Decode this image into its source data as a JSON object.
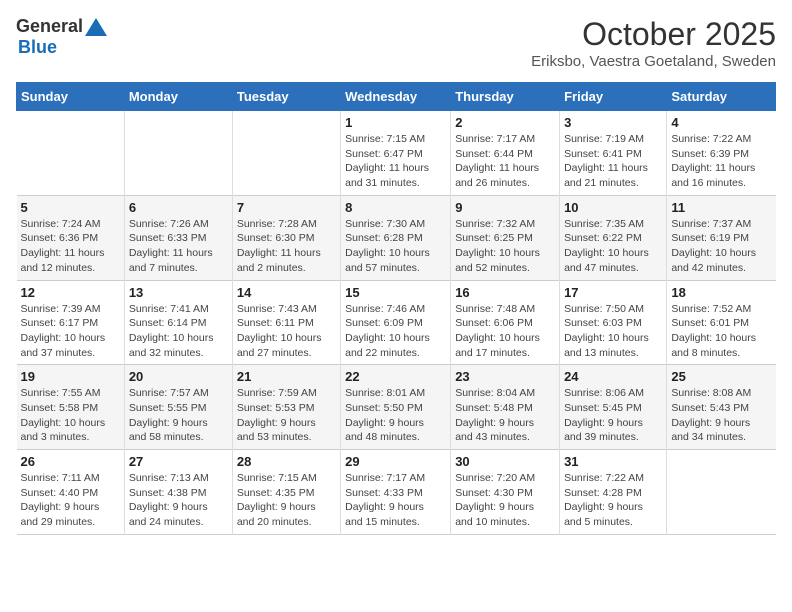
{
  "header": {
    "logo_general": "General",
    "logo_blue": "Blue",
    "month": "October 2025",
    "location": "Eriksbo, Vaestra Goetaland, Sweden"
  },
  "days_of_week": [
    "Sunday",
    "Monday",
    "Tuesday",
    "Wednesday",
    "Thursday",
    "Friday",
    "Saturday"
  ],
  "weeks": [
    [
      {
        "day": "",
        "info": ""
      },
      {
        "day": "",
        "info": ""
      },
      {
        "day": "",
        "info": ""
      },
      {
        "day": "1",
        "info": "Sunrise: 7:15 AM\nSunset: 6:47 PM\nDaylight: 11 hours\nand 31 minutes."
      },
      {
        "day": "2",
        "info": "Sunrise: 7:17 AM\nSunset: 6:44 PM\nDaylight: 11 hours\nand 26 minutes."
      },
      {
        "day": "3",
        "info": "Sunrise: 7:19 AM\nSunset: 6:41 PM\nDaylight: 11 hours\nand 21 minutes."
      },
      {
        "day": "4",
        "info": "Sunrise: 7:22 AM\nSunset: 6:39 PM\nDaylight: 11 hours\nand 16 minutes."
      }
    ],
    [
      {
        "day": "5",
        "info": "Sunrise: 7:24 AM\nSunset: 6:36 PM\nDaylight: 11 hours\nand 12 minutes."
      },
      {
        "day": "6",
        "info": "Sunrise: 7:26 AM\nSunset: 6:33 PM\nDaylight: 11 hours\nand 7 minutes."
      },
      {
        "day": "7",
        "info": "Sunrise: 7:28 AM\nSunset: 6:30 PM\nDaylight: 11 hours\nand 2 minutes."
      },
      {
        "day": "8",
        "info": "Sunrise: 7:30 AM\nSunset: 6:28 PM\nDaylight: 10 hours\nand 57 minutes."
      },
      {
        "day": "9",
        "info": "Sunrise: 7:32 AM\nSunset: 6:25 PM\nDaylight: 10 hours\nand 52 minutes."
      },
      {
        "day": "10",
        "info": "Sunrise: 7:35 AM\nSunset: 6:22 PM\nDaylight: 10 hours\nand 47 minutes."
      },
      {
        "day": "11",
        "info": "Sunrise: 7:37 AM\nSunset: 6:19 PM\nDaylight: 10 hours\nand 42 minutes."
      }
    ],
    [
      {
        "day": "12",
        "info": "Sunrise: 7:39 AM\nSunset: 6:17 PM\nDaylight: 10 hours\nand 37 minutes."
      },
      {
        "day": "13",
        "info": "Sunrise: 7:41 AM\nSunset: 6:14 PM\nDaylight: 10 hours\nand 32 minutes."
      },
      {
        "day": "14",
        "info": "Sunrise: 7:43 AM\nSunset: 6:11 PM\nDaylight: 10 hours\nand 27 minutes."
      },
      {
        "day": "15",
        "info": "Sunrise: 7:46 AM\nSunset: 6:09 PM\nDaylight: 10 hours\nand 22 minutes."
      },
      {
        "day": "16",
        "info": "Sunrise: 7:48 AM\nSunset: 6:06 PM\nDaylight: 10 hours\nand 17 minutes."
      },
      {
        "day": "17",
        "info": "Sunrise: 7:50 AM\nSunset: 6:03 PM\nDaylight: 10 hours\nand 13 minutes."
      },
      {
        "day": "18",
        "info": "Sunrise: 7:52 AM\nSunset: 6:01 PM\nDaylight: 10 hours\nand 8 minutes."
      }
    ],
    [
      {
        "day": "19",
        "info": "Sunrise: 7:55 AM\nSunset: 5:58 PM\nDaylight: 10 hours\nand 3 minutes."
      },
      {
        "day": "20",
        "info": "Sunrise: 7:57 AM\nSunset: 5:55 PM\nDaylight: 9 hours\nand 58 minutes."
      },
      {
        "day": "21",
        "info": "Sunrise: 7:59 AM\nSunset: 5:53 PM\nDaylight: 9 hours\nand 53 minutes."
      },
      {
        "day": "22",
        "info": "Sunrise: 8:01 AM\nSunset: 5:50 PM\nDaylight: 9 hours\nand 48 minutes."
      },
      {
        "day": "23",
        "info": "Sunrise: 8:04 AM\nSunset: 5:48 PM\nDaylight: 9 hours\nand 43 minutes."
      },
      {
        "day": "24",
        "info": "Sunrise: 8:06 AM\nSunset: 5:45 PM\nDaylight: 9 hours\nand 39 minutes."
      },
      {
        "day": "25",
        "info": "Sunrise: 8:08 AM\nSunset: 5:43 PM\nDaylight: 9 hours\nand 34 minutes."
      }
    ],
    [
      {
        "day": "26",
        "info": "Sunrise: 7:11 AM\nSunset: 4:40 PM\nDaylight: 9 hours\nand 29 minutes."
      },
      {
        "day": "27",
        "info": "Sunrise: 7:13 AM\nSunset: 4:38 PM\nDaylight: 9 hours\nand 24 minutes."
      },
      {
        "day": "28",
        "info": "Sunrise: 7:15 AM\nSunset: 4:35 PM\nDaylight: 9 hours\nand 20 minutes."
      },
      {
        "day": "29",
        "info": "Sunrise: 7:17 AM\nSunset: 4:33 PM\nDaylight: 9 hours\nand 15 minutes."
      },
      {
        "day": "30",
        "info": "Sunrise: 7:20 AM\nSunset: 4:30 PM\nDaylight: 9 hours\nand 10 minutes."
      },
      {
        "day": "31",
        "info": "Sunrise: 7:22 AM\nSunset: 4:28 PM\nDaylight: 9 hours\nand 5 minutes."
      },
      {
        "day": "",
        "info": ""
      }
    ]
  ]
}
